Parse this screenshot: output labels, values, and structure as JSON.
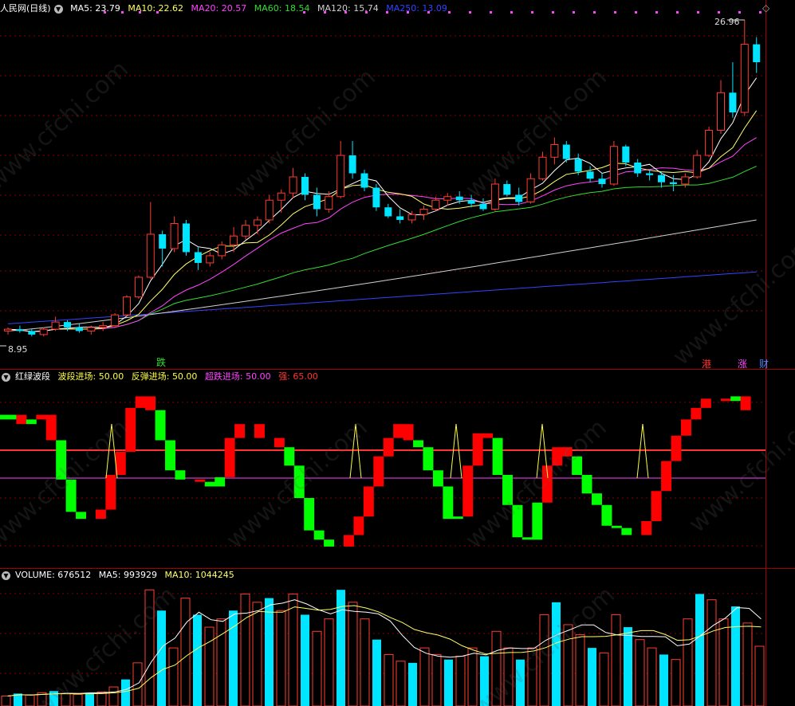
{
  "colors": {
    "up": "#ff3b30",
    "down": "#00e5ff",
    "ma5": "#ffffff",
    "ma10": "#ffff66",
    "ma20": "#ff44ff",
    "ma60": "#33dd33",
    "ma120": "#d0d0d0",
    "ma250": "#3344ff",
    "grid": "#8b0000",
    "red": "#ff0000",
    "green": "#00ff00"
  },
  "price_panel": {
    "title": "人民网(日线)",
    "ma": [
      {
        "label": "MA5:",
        "value": "23.79",
        "color": "#ffffff"
      },
      {
        "label": "MA10:",
        "value": "22.62",
        "color": "#ffff66"
      },
      {
        "label": "MA20:",
        "value": "20.57",
        "color": "#ff44ff"
      },
      {
        "label": "MA60:",
        "value": "18.54",
        "color": "#33dd33"
      },
      {
        "label": "MA120:",
        "value": "15.74",
        "color": "#d0d0d0"
      },
      {
        "label": "MA250:",
        "value": "13.09",
        "color": "#3344ff"
      }
    ],
    "high_label": "26.96",
    "low_label": "8.95",
    "badges": {
      "left": "跌",
      "right1": "港",
      "right2": "涨",
      "right3": "财"
    },
    "icon": "diamond-icon"
  },
  "indicator_panel": {
    "title": "红绿波段",
    "items": [
      {
        "label": "波段进场:",
        "value": "50.00",
        "color": "#ffff44"
      },
      {
        "label": "反弹进场:",
        "value": "50.00",
        "color": "#ffff44"
      },
      {
        "label": "超跌进场:",
        "value": "50.00",
        "color": "#ff44ff"
      },
      {
        "label": "强:",
        "value": "65.00",
        "color": "#ff3333"
      }
    ]
  },
  "volume_panel": {
    "title": "VOLUME:",
    "value": "676512",
    "ma5_label": "MA5:",
    "ma5_value": "993929",
    "ma10_label": "MA10:",
    "ma10_value": "1044245"
  },
  "watermark": "www.cfchi.com",
  "chart_data": {
    "type": "candlestick",
    "n": 64,
    "candles": [
      [
        9.6,
        9.8,
        9.4,
        9.7
      ],
      [
        9.7,
        9.9,
        9.5,
        9.6
      ],
      [
        9.6,
        9.7,
        9.3,
        9.4
      ],
      [
        9.4,
        9.8,
        9.3,
        9.7
      ],
      [
        9.7,
        10.4,
        9.6,
        10.1
      ],
      [
        10.1,
        10.2,
        9.6,
        9.8
      ],
      [
        9.8,
        10.0,
        9.5,
        9.6
      ],
      [
        9.6,
        9.9,
        9.4,
        9.8
      ],
      [
        9.8,
        10.1,
        9.6,
        9.9
      ],
      [
        9.9,
        10.6,
        9.8,
        10.5
      ],
      [
        10.5,
        11.6,
        10.4,
        11.5
      ],
      [
        11.5,
        12.7,
        11.4,
        12.6
      ],
      [
        12.6,
        16.8,
        12.5,
        15.0
      ],
      [
        15.0,
        15.2,
        13.2,
        14.2
      ],
      [
        14.2,
        16.0,
        14.0,
        15.6
      ],
      [
        15.6,
        15.8,
        13.8,
        14.0
      ],
      [
        14.0,
        14.3,
        13.0,
        13.4
      ],
      [
        13.4,
        14.0,
        13.2,
        13.8
      ],
      [
        13.8,
        14.6,
        13.6,
        14.4
      ],
      [
        14.4,
        15.4,
        14.0,
        14.9
      ],
      [
        14.9,
        15.8,
        14.7,
        15.5
      ],
      [
        15.5,
        16.0,
        15.0,
        15.8
      ],
      [
        15.8,
        17.2,
        15.6,
        16.9
      ],
      [
        16.9,
        17.5,
        16.2,
        17.3
      ],
      [
        17.3,
        18.7,
        17.0,
        18.2
      ],
      [
        18.2,
        18.4,
        16.9,
        17.2
      ],
      [
        17.2,
        17.6,
        16.0,
        16.4
      ],
      [
        16.4,
        17.4,
        16.2,
        17.1
      ],
      [
        17.1,
        20.2,
        17.0,
        19.4
      ],
      [
        19.4,
        20.2,
        18.1,
        18.4
      ],
      [
        18.4,
        18.6,
        17.4,
        17.6
      ],
      [
        17.6,
        17.8,
        16.3,
        16.5
      ],
      [
        16.5,
        16.7,
        15.9,
        16.0
      ],
      [
        16.0,
        16.4,
        15.6,
        15.8
      ],
      [
        15.8,
        16.3,
        15.6,
        16.1
      ],
      [
        16.1,
        16.6,
        15.8,
        16.4
      ],
      [
        16.4,
        17.1,
        16.3,
        16.9
      ],
      [
        16.9,
        17.3,
        16.6,
        17.1
      ],
      [
        17.1,
        17.4,
        16.7,
        16.9
      ],
      [
        16.9,
        17.2,
        16.5,
        16.7
      ],
      [
        16.7,
        17.0,
        16.3,
        16.4
      ],
      [
        16.4,
        18.1,
        16.3,
        17.8
      ],
      [
        17.8,
        18.0,
        17.1,
        17.2
      ],
      [
        17.2,
        17.6,
        16.6,
        16.8
      ],
      [
        16.8,
        18.4,
        16.7,
        18.1
      ],
      [
        18.1,
        19.6,
        18.0,
        19.3
      ],
      [
        19.3,
        20.4,
        18.9,
        20.0
      ],
      [
        20.0,
        20.2,
        19.0,
        19.2
      ],
      [
        19.2,
        19.5,
        18.3,
        18.5
      ],
      [
        18.5,
        18.8,
        17.9,
        18.1
      ],
      [
        18.1,
        18.4,
        17.6,
        17.8
      ],
      [
        17.8,
        20.2,
        17.7,
        19.9
      ],
      [
        19.9,
        20.0,
        18.8,
        19.0
      ],
      [
        19.0,
        19.2,
        18.2,
        18.4
      ],
      [
        18.4,
        18.6,
        18.0,
        18.3
      ],
      [
        18.3,
        18.5,
        17.6,
        17.9
      ],
      [
        17.9,
        18.3,
        17.4,
        17.8
      ],
      [
        17.8,
        18.4,
        17.6,
        18.2
      ],
      [
        18.2,
        19.7,
        18.1,
        19.4
      ],
      [
        19.4,
        21.0,
        19.3,
        20.8
      ],
      [
        20.8,
        23.6,
        20.6,
        22.9
      ],
      [
        22.9,
        24.6,
        21.5,
        21.8
      ],
      [
        21.8,
        26.96,
        21.6,
        25.6
      ],
      [
        25.6,
        26.0,
        24.0,
        24.6
      ]
    ],
    "wave": [
      66,
      64,
      66,
      62,
      64,
      66,
      55,
      38,
      24,
      21,
      21,
      25,
      40,
      50,
      69,
      74,
      68,
      55,
      42,
      38,
      38,
      37,
      35,
      39,
      56,
      62,
      62,
      56,
      56,
      52,
      44,
      30,
      16,
      12,
      9,
      9,
      14,
      22,
      35,
      48,
      56,
      62,
      55,
      52,
      42,
      35,
      21,
      22,
      44,
      58,
      56,
      40,
      27,
      13,
      12,
      28,
      44,
      52,
      48,
      40,
      32,
      27,
      18,
      17,
      14,
      14,
      20,
      33,
      46,
      57,
      64,
      69,
      73,
      73,
      72,
      74,
      68
    ],
    "volume": [
      120,
      150,
      130,
      160,
      180,
      150,
      140,
      160,
      170,
      230,
      320,
      520,
      1400,
      1150,
      700,
      1300,
      1100,
      950,
      1050,
      1150,
      1350,
      1250,
      1300,
      1150,
      1350,
      1100,
      900,
      1050,
      1400,
      1250,
      1050,
      800,
      620,
      540,
      520,
      700,
      620,
      560,
      600,
      700,
      600,
      900,
      700,
      560,
      700,
      1100,
      1250,
      980,
      860,
      700,
      640,
      1100,
      950,
      800,
      700,
      620,
      560,
      1050,
      1350,
      1280,
      1050,
      1200,
      1000,
      720
    ]
  }
}
